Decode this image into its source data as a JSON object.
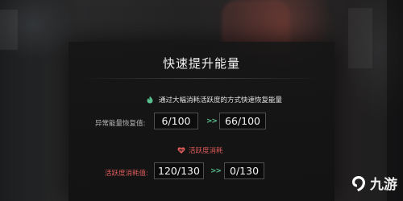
{
  "panel": {
    "title": "快速提升能量",
    "hint": "通过大幅消耗活跃度的方式快速恢复能量",
    "energy": {
      "label": "异常能量恢复值:",
      "current": "6/100",
      "arrow": ">>",
      "after": "66/100"
    },
    "activity_section": "活跃度消耗",
    "activity": {
      "label": "活跃度消耗值:",
      "current": "120/130",
      "arrow": ">>",
      "after": "0/130"
    }
  },
  "watermark": {
    "text": "九游"
  },
  "icons": {
    "hint": "flame-icon",
    "section": "heart-icon",
    "watermark_logo": "nine-game-logo"
  },
  "colors": {
    "accent_green": "#58c08e",
    "accent_red": "#e05b5b"
  }
}
